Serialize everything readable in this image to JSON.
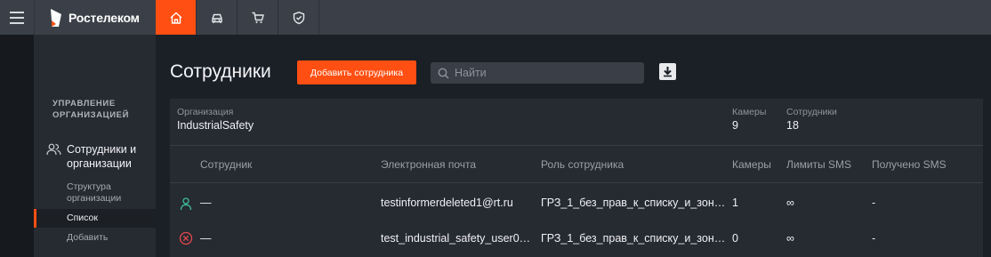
{
  "topbar": {
    "brand": "Ростелеком",
    "menu_icon": "hamburger-icon",
    "tabs": [
      {
        "icon": "home-icon",
        "active": true
      },
      {
        "icon": "car-icon",
        "active": false
      },
      {
        "icon": "cart-icon",
        "active": false
      },
      {
        "icon": "shield-icon",
        "active": false
      }
    ]
  },
  "sidebar": {
    "section_title_line1": "УПРАВЛЕНИЕ",
    "section_title_line2": "ОРГАНИЗАЦИЕЙ",
    "main_item_line1": "Сотрудники и",
    "main_item_line2": "организации",
    "main_item_icon": "people-icon",
    "sub_items": {
      "structure_line1": "Структура",
      "structure_line2": "организации",
      "list": "Список",
      "add": "Добавить"
    }
  },
  "page": {
    "title": "Сотрудники",
    "add_button": "Добавить сотрудника",
    "search_placeholder": "Найти",
    "download_icon": "download-icon"
  },
  "org": {
    "org_label": "Организация",
    "org_value": "IndustrialSafety",
    "cameras_label": "Камеры",
    "cameras_value": "9",
    "employees_label": "Сотрудники",
    "employees_value": "18"
  },
  "table": {
    "headers": {
      "employee": "Сотрудник",
      "email": "Электронная почта",
      "role": "Роль сотрудника",
      "cameras": "Камеры",
      "sms_limits": "Лимиты SMS",
      "sms_received": "Получено SMS"
    },
    "rows": [
      {
        "status_icon": "user-active-icon",
        "name": "—",
        "email": "testinformerdeleted1@rt.ru",
        "role": "ГРЗ_1_без_прав_к_списку_и_зон…",
        "cameras": "1",
        "sms_limits": "∞",
        "sms_received": "-"
      },
      {
        "status_icon": "user-blocked-icon",
        "name": "—",
        "email": "test_industrial_safety_user0…",
        "role": "ГРЗ_1_без_прав_к_списку_и_зон…",
        "cameras": "0",
        "sms_limits": "∞",
        "sms_received": "-"
      }
    ]
  },
  "colors": {
    "accent": "#ff4f12",
    "active_status": "#3fbf9b",
    "blocked_status": "#e5484d"
  }
}
